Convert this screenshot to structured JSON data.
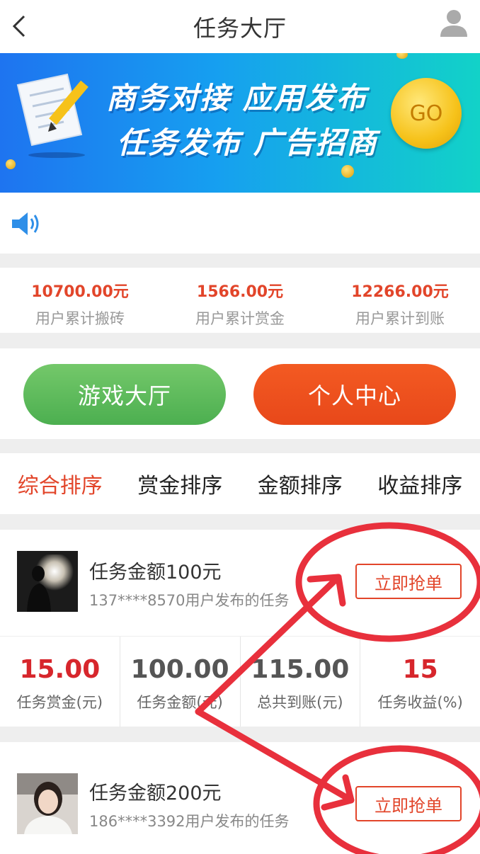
{
  "header": {
    "title": "任务大厅"
  },
  "banner": {
    "line1": "商务对接 应用发布",
    "line2": "任务发布 广告招商",
    "go_label": "GO"
  },
  "stats": [
    {
      "value": "10700.00元",
      "label": "用户累计搬砖"
    },
    {
      "value": "1566.00元",
      "label": "用户累计赏金"
    },
    {
      "value": "12266.00元",
      "label": "用户累计到账"
    }
  ],
  "buttons": {
    "game_hall": "游戏大厅",
    "personal_center": "个人中心"
  },
  "sort_tabs": [
    {
      "label": "综合排序",
      "active": true
    },
    {
      "label": "赏金排序"
    },
    {
      "label": "金额排序"
    },
    {
      "label": "收益排序"
    }
  ],
  "tasks": [
    {
      "title": "任务金额100元",
      "desc": "137****8570用户发布的任务",
      "button": "立即抢单",
      "metrics": [
        {
          "value": "15.00",
          "label": "任务赏金(元)"
        },
        {
          "value": "100.00",
          "label": "任务金额(元)"
        },
        {
          "value": "115.00",
          "label": "总共到账(元)"
        },
        {
          "value": "15",
          "label": "任务收益(%)"
        }
      ]
    },
    {
      "title": "任务金额200元",
      "desc": "186****3392用户发布的任务",
      "button": "立即抢单"
    }
  ],
  "colors": {
    "accent": "#e2452a",
    "green": "#4caf50",
    "annotation": "#e8303c"
  }
}
